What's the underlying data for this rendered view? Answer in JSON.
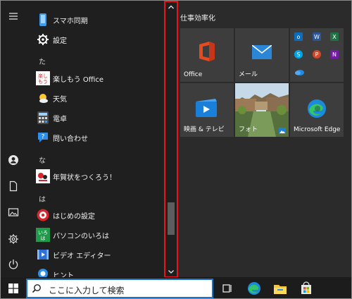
{
  "app_list": {
    "items": [
      {
        "kind": "app",
        "label": "スマホ同期",
        "icon": "phone-link-icon"
      },
      {
        "kind": "app",
        "label": "設定",
        "icon": "settings-gear-icon"
      },
      {
        "kind": "letter",
        "label": "た"
      },
      {
        "kind": "app",
        "label": "楽しもう Office",
        "icon": "office-fun-icon"
      },
      {
        "kind": "app",
        "label": "天気",
        "icon": "weather-icon"
      },
      {
        "kind": "app",
        "label": "電卓",
        "icon": "calculator-icon"
      },
      {
        "kind": "app",
        "label": "問い合わせ",
        "icon": "get-help-icon"
      },
      {
        "kind": "letter",
        "label": "な"
      },
      {
        "kind": "app",
        "label": "年賀状をつくろう！",
        "icon": "new-year-card-icon"
      },
      {
        "kind": "letter",
        "label": "は"
      },
      {
        "kind": "app",
        "label": "はじめの設定",
        "icon": "initial-setup-icon"
      },
      {
        "kind": "app",
        "label": "パソコンのいろは",
        "icon": "pc-basics-icon"
      },
      {
        "kind": "app",
        "label": "ビデオ エディター",
        "icon": "video-editor-icon"
      },
      {
        "kind": "app",
        "label": "ヒント",
        "icon": "tips-icon"
      }
    ]
  },
  "tiles": {
    "group_title": "仕事効率化",
    "office": "Office",
    "mail": "メール",
    "movies": "映画 & テレビ",
    "photos": "フォト",
    "edge": "Microsoft Edge"
  },
  "taskbar": {
    "search_text": "ここに入力して検索"
  },
  "colors": {
    "highlight_border": "#e8141a",
    "accent": "#1a73c8"
  }
}
